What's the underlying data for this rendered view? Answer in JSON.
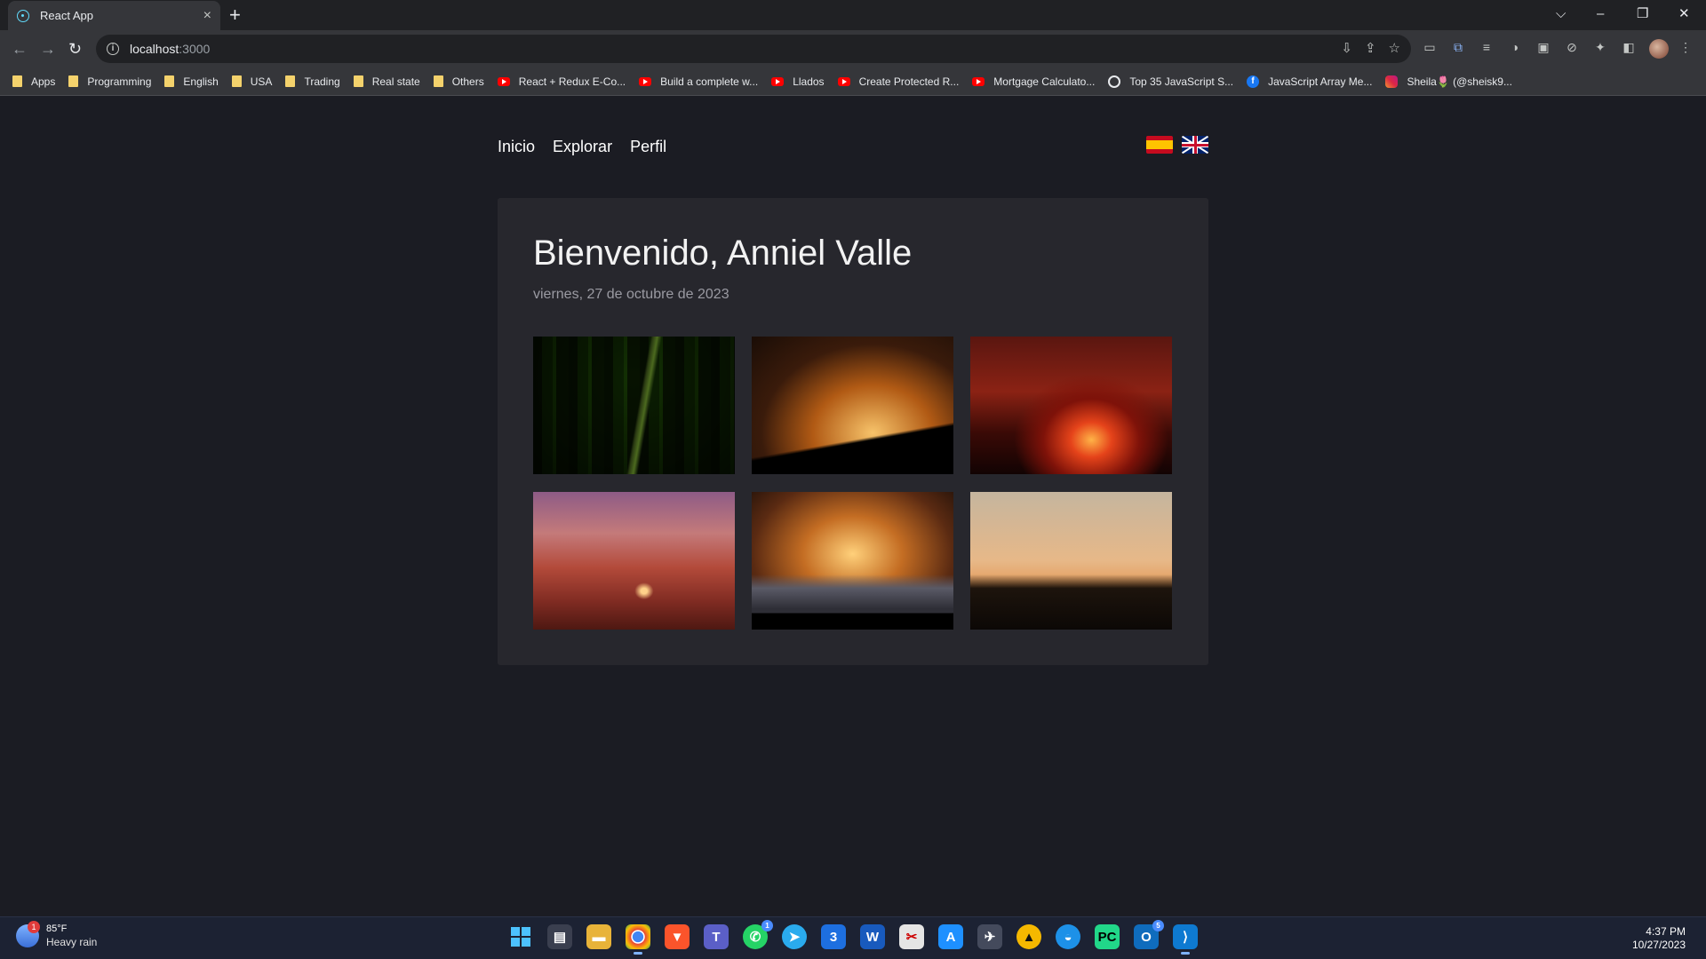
{
  "browser": {
    "tab_title": "React App",
    "tab_close": "×",
    "new_tab": "+",
    "url_host": "localhost",
    "url_port": ":3000",
    "window_controls": [
      "⌵",
      "–",
      "❐",
      "✕"
    ],
    "nav_buttons": {
      "back": "←",
      "forward": "→",
      "reload": "↻"
    },
    "omnibox_icons": [
      "⇩",
      "⇪",
      "☆"
    ],
    "bookmarks": [
      {
        "label": "Apps",
        "icon": "folder"
      },
      {
        "label": "Programming",
        "icon": "folder"
      },
      {
        "label": "English",
        "icon": "folder"
      },
      {
        "label": "USA",
        "icon": "folder"
      },
      {
        "label": "Trading",
        "icon": "folder"
      },
      {
        "label": "Real state",
        "icon": "folder"
      },
      {
        "label": "Others",
        "icon": "folder"
      },
      {
        "label": "React + Redux E-Co...",
        "icon": "youtube"
      },
      {
        "label": "Build a complete w...",
        "icon": "youtube"
      },
      {
        "label": "Llados",
        "icon": "youtube"
      },
      {
        "label": "Create Protected R...",
        "icon": "youtube"
      },
      {
        "label": "Mortgage Calculato...",
        "icon": "youtube"
      },
      {
        "label": "Top 35 JavaScript S...",
        "icon": "generic"
      },
      {
        "label": "JavaScript Array Me...",
        "icon": "facebook"
      },
      {
        "label": "Sheila🌷 (@sheisk9...",
        "icon": "instagram"
      }
    ]
  },
  "nav": {
    "home": "Inicio",
    "explore": "Explorar",
    "profile": "Perfil"
  },
  "languages": [
    "es-flag-icon",
    "uk-flag-icon"
  ],
  "main": {
    "welcome": "Bienvenido, Anniel Valle",
    "date": "viernes, 27 de octubre de 2023",
    "photos": [
      "forest",
      "storm-mountains",
      "lava-flow",
      "desert-road",
      "cloud-peaks",
      "sunset-trees"
    ]
  },
  "taskbar": {
    "weather_temp": "85°F",
    "weather_desc": "Heavy rain",
    "weather_badge": "1",
    "time": "4:37 PM",
    "date": "10/27/2023",
    "whatsapp_badge": "1",
    "outlook_badge": "5"
  },
  "colors": {
    "page_bg": "#1b1c23",
    "card_bg": "#27272d",
    "taskbar_bg": "#1c2233"
  }
}
